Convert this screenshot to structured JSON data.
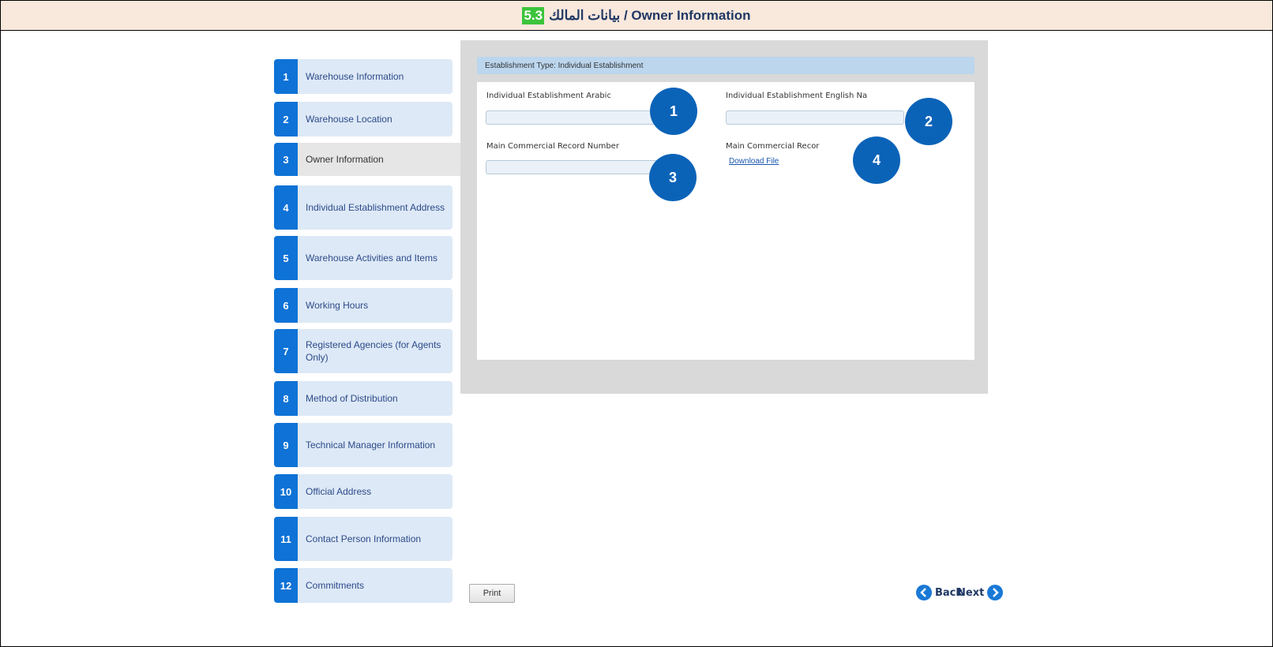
{
  "header": {
    "section_number": "5.3",
    "title": "بيانات المالك / Owner Information"
  },
  "sidebar": {
    "steps": [
      {
        "num": "1",
        "label": "Warehouse Information"
      },
      {
        "num": "2",
        "label": "Warehouse Location"
      },
      {
        "num": "3",
        "label": "Owner Information",
        "active": true
      },
      {
        "num": "4",
        "label": "Individual Establishment Address"
      },
      {
        "num": "5",
        "label": "Warehouse Activities and Items"
      },
      {
        "num": "6",
        "label": "Working Hours"
      },
      {
        "num": "7",
        "label": "Registered Agencies (for Agents Only)"
      },
      {
        "num": "8",
        "label": "Method of Distribution"
      },
      {
        "num": "9",
        "label": "Technical Manager Information"
      },
      {
        "num": "10",
        "label": "Official Address"
      },
      {
        "num": "11",
        "label": "Contact Person Information"
      },
      {
        "num": "12",
        "label": "Commitments"
      }
    ]
  },
  "form": {
    "establishment_type": "Establishment Type: Individual Establishment",
    "fields": {
      "arabic_name_label": "Individual Establishment Arabic",
      "english_name_label": "Individual Establishment English Na",
      "cr_number_label": "Main Commercial Record Number",
      "cr_file_label": "Main Commercial Recor"
    },
    "download_link": "Download File",
    "markers": [
      "1",
      "2",
      "3",
      "4"
    ]
  },
  "buttons": {
    "print": "Print",
    "back": "Back",
    "next": "Next"
  },
  "colors": {
    "step_number_bg": "#0e72d6",
    "step_bg": "#dde9f6",
    "marker_bg": "#0b63b8",
    "title_highlight": "#3cc43c"
  }
}
